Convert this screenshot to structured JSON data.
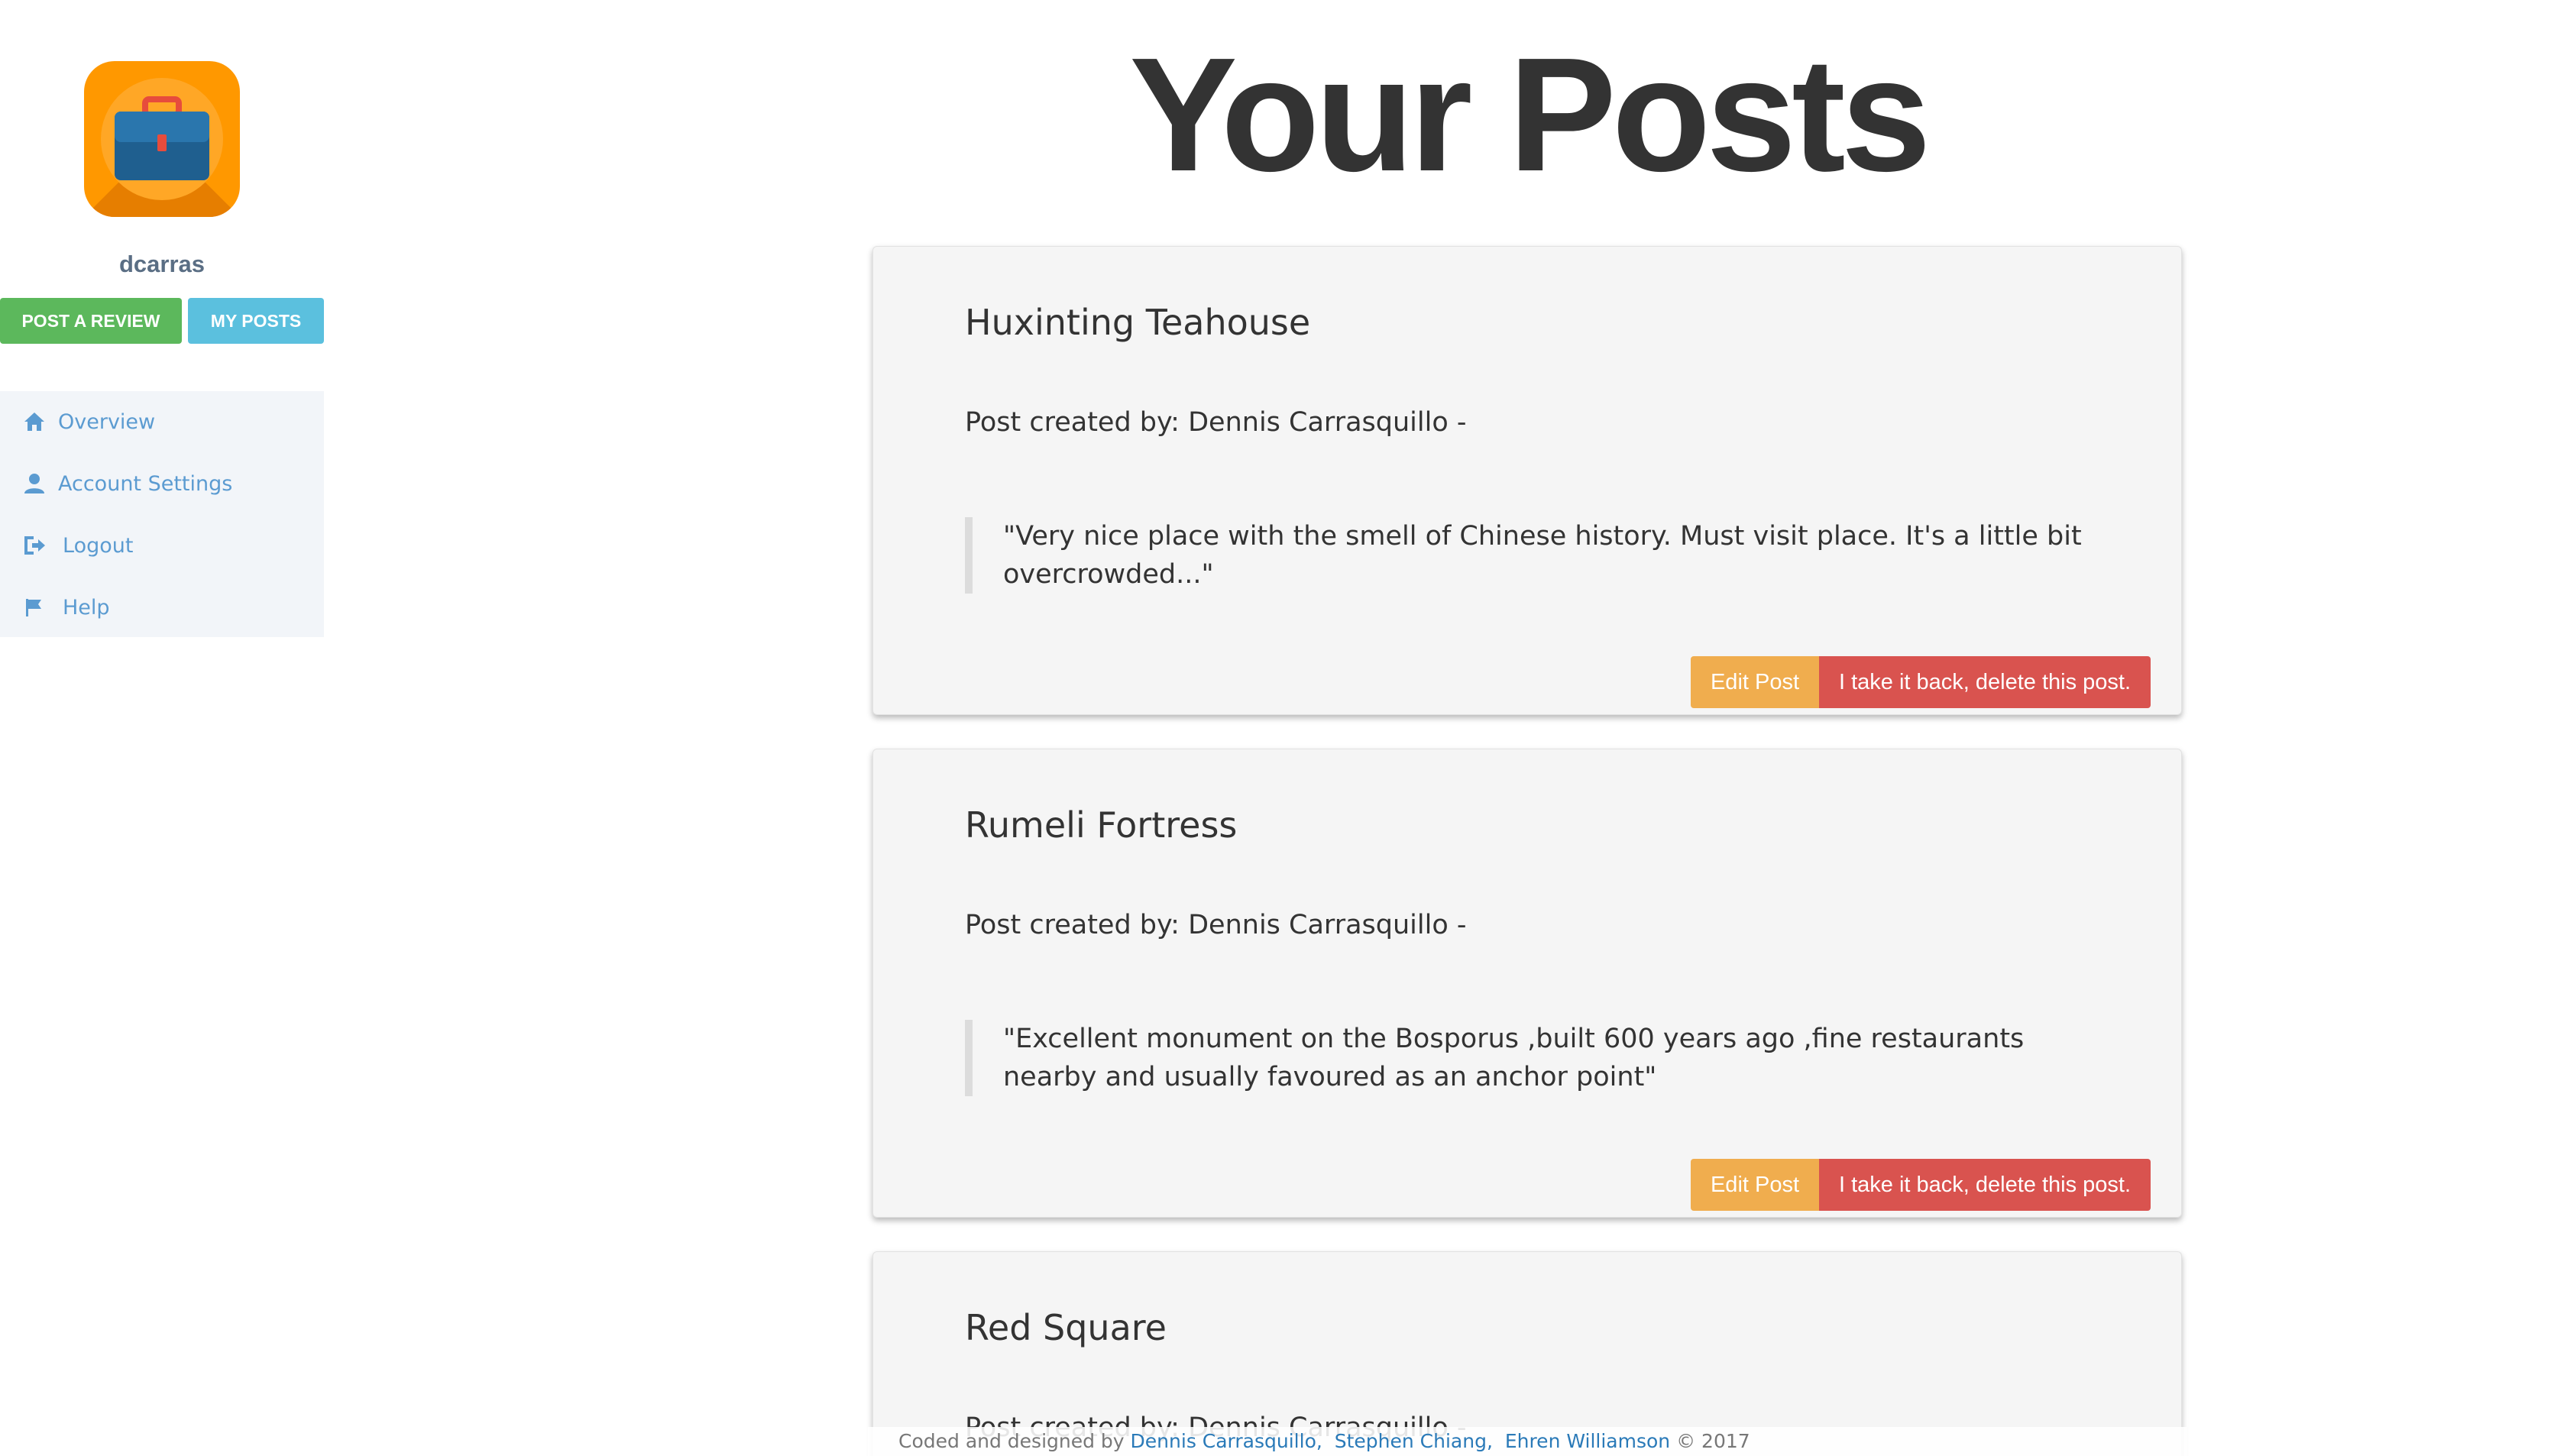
{
  "sidebar": {
    "username": "dcarras",
    "post_review_label": "POST A REVIEW",
    "my_posts_label": "MY POSTS",
    "nav": [
      {
        "label": "Overview",
        "icon": "home-icon"
      },
      {
        "label": "Account Settings",
        "icon": "user-icon"
      },
      {
        "label": "Logout",
        "icon": "logout-icon"
      },
      {
        "label": "Help",
        "icon": "flag-icon"
      }
    ]
  },
  "main": {
    "title": "Your Posts",
    "posts": [
      {
        "title": "Huxinting Teahouse",
        "author_line": "Post created by: Dennis Carrasquillo -",
        "quote": "\"Very nice place with the smell of Chinese history. Must visit place. It's a little bit overcrowded...\"",
        "edit_label": "Edit Post",
        "delete_label": "I take it back, delete this post."
      },
      {
        "title": "Rumeli Fortress",
        "author_line": "Post created by: Dennis Carrasquillo -",
        "quote": "\"Excellent monument on the Bosporus ,built 600 years ago ,fine restaurants nearby and usually favoured as an anchor point\"",
        "edit_label": "Edit Post",
        "delete_label": "I take it back, delete this post."
      },
      {
        "title": "Red Square",
        "author_line": "Post created by: Dennis Carrasquillo -"
      }
    ]
  },
  "footer": {
    "prefix": "Coded and designed by",
    "authors": [
      "Dennis Carrasquillo,",
      "Stephen Chiang,",
      "Ehren Williamson"
    ],
    "suffix": "© 2017"
  },
  "colors": {
    "post_review_button": "#5cb85c",
    "my_posts_button": "#5bc0de",
    "edit_button": "#f0ad4e",
    "delete_button": "#d9534f",
    "link": "#2a7ab8"
  }
}
